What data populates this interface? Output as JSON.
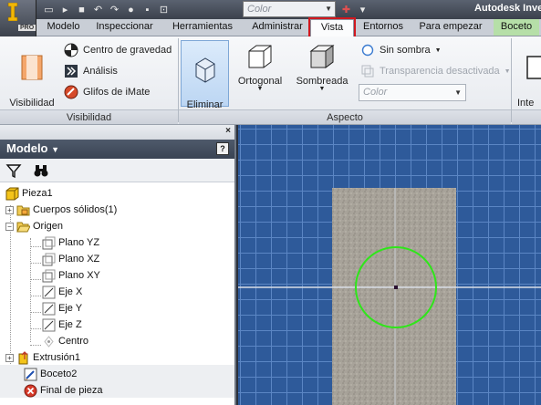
{
  "app": {
    "title": "Autodesk Inve",
    "edition": "PRO"
  },
  "qat": {
    "color_placeholder": "Color"
  },
  "tabs": [
    {
      "label": "Modelo"
    },
    {
      "label": "Inspeccionar"
    },
    {
      "label": "Herramientas"
    },
    {
      "label": "Administrar"
    },
    {
      "label": "Vista"
    },
    {
      "label": "Entornos"
    },
    {
      "label": "Para empezar"
    },
    {
      "label": "Boceto"
    }
  ],
  "ribbon": {
    "visibilidad": {
      "panel_label": "Visibilidad",
      "object_visibility_label": "Visibilidad\ndel objeto",
      "center_gravity_label": "Centro de gravedad",
      "analysis_label": "Análisis",
      "imate_label": "Glifos de iMate"
    },
    "aspecto": {
      "panel_label": "Aspecto",
      "remove_material_label": "Eliminar\nmaterial",
      "orthographic_label": "Ortogonal",
      "shaded_label": "Sombreada",
      "no_shadow_label": "Sin sombra",
      "transparency_label": "Transparencia desactivada",
      "color_placeholder": "Color"
    },
    "partial_label": "Inte\nus"
  },
  "browser": {
    "title": "Modelo",
    "help_label": "?",
    "close_label": "×",
    "tree": [
      {
        "label": "Pieza1"
      },
      {
        "label": "Cuerpos sólidos(1)"
      },
      {
        "label": "Origen"
      },
      {
        "label": "Plano YZ"
      },
      {
        "label": "Plano XZ"
      },
      {
        "label": "Plano XY"
      },
      {
        "label": "Eje X"
      },
      {
        "label": "Eje Y"
      },
      {
        "label": "Eje Z"
      },
      {
        "label": "Centro"
      },
      {
        "label": "Extrusión1"
      },
      {
        "label": "Boceto2"
      },
      {
        "label": "Final de pieza"
      }
    ]
  },
  "colors": {
    "highlight_tab_outline": "#d0181f",
    "sketch_circle": "#2fe61a",
    "viewport_bg": "#2e5a9a",
    "boceto_tab": "#b6dfa8"
  }
}
